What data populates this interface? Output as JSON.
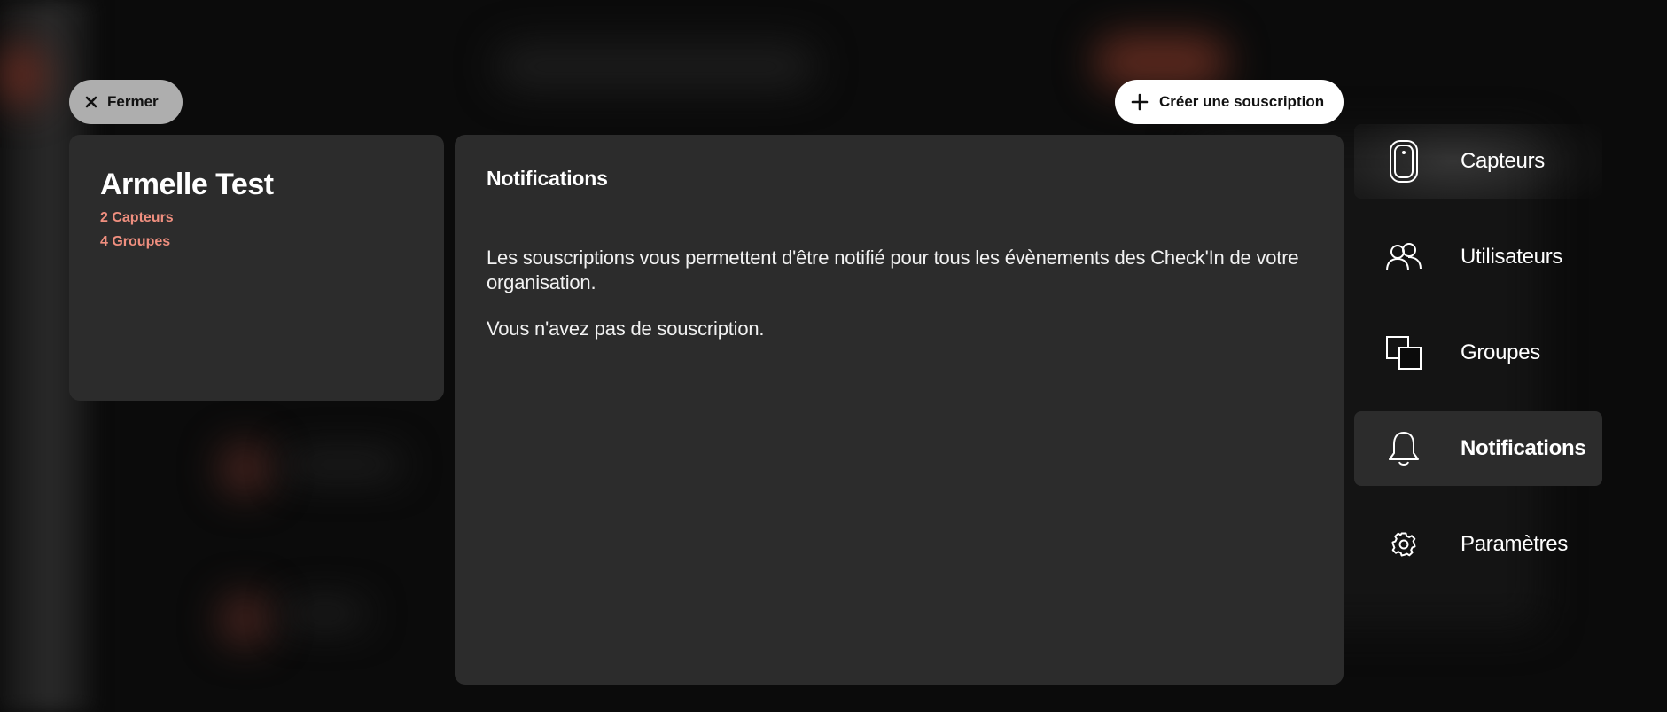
{
  "buttons": {
    "close_label": "Fermer",
    "create_label": "Créer une souscription"
  },
  "profile": {
    "name": "Armelle Test",
    "sensors": "2 Capteurs",
    "groups": "4 Groupes"
  },
  "panel": {
    "title": "Notifications",
    "description": "Les souscriptions vous permettent d'être notifié pour tous les évènements des Check'In de votre organisation.",
    "empty_message": "Vous n'avez pas de souscription."
  },
  "menu": {
    "items": [
      {
        "label": "Capteurs",
        "icon": "sensor-icon"
      },
      {
        "label": "Utilisateurs",
        "icon": "users-icon"
      },
      {
        "label": "Groupes",
        "icon": "groups-icon"
      },
      {
        "label": "Notifications",
        "icon": "bell-icon",
        "active": true
      },
      {
        "label": "Paramètres",
        "icon": "gear-icon"
      }
    ]
  },
  "colors": {
    "accent": "#f08f7f",
    "panel": "#2c2c2c",
    "background": "#0b0b0b"
  }
}
